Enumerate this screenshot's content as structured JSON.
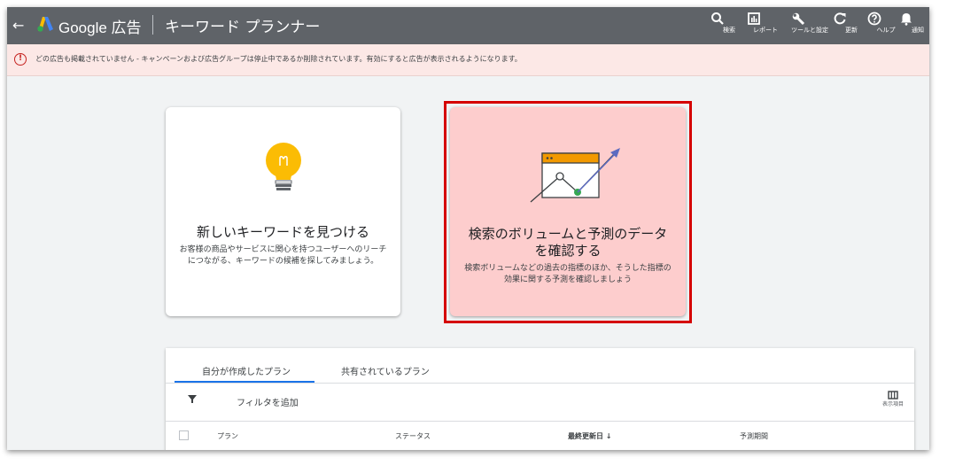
{
  "topbar": {
    "back_glyph": "←",
    "brand": "Google 広告",
    "page_title": "キーワード プランナー",
    "tools": [
      {
        "icon": "search-icon",
        "label": "検索"
      },
      {
        "icon": "reports-icon",
        "label": "レポート"
      },
      {
        "icon": "wrench-icon",
        "label": "ツールと設定"
      },
      {
        "icon": "refresh-icon",
        "label": "更新"
      },
      {
        "icon": "help-icon",
        "label": "ヘルプ"
      },
      {
        "icon": "bell-icon",
        "label": "通知"
      }
    ]
  },
  "alert": {
    "icon_glyph": "!",
    "text": "どの広告も掲載されていません - キャンペーンおよび広告グループは停止中であるか削除されています。有効にすると広告が表示されるようになります。"
  },
  "cards": {
    "discover": {
      "title": "新しいキーワードを見つける",
      "description": "お客様の商品やサービスに関心を持つユーザーへのリーチにつながる、キーワードの候補を探してみましょう。"
    },
    "forecast": {
      "title": "検索のボリュームと予測のデータを確認する",
      "description": "検索ボリュームなどの過去の指標のほか、そうした指標の効果に関する予測を確認しましょう"
    }
  },
  "plans": {
    "tabs": [
      "自分が作成したプラン",
      "共有されているプラン"
    ],
    "filter_label": "フィルタを追加",
    "columns_label": "表示項目",
    "headers": [
      "プラン",
      "ステータス",
      "最終更新日 ↓",
      "予測期間"
    ]
  },
  "colors": {
    "topbar": "#5f6368",
    "alert_bg": "#fce8e6",
    "highlight": "#d50000",
    "selected_card": "#fdcdcd",
    "tab_accent": "#1a73e8"
  }
}
